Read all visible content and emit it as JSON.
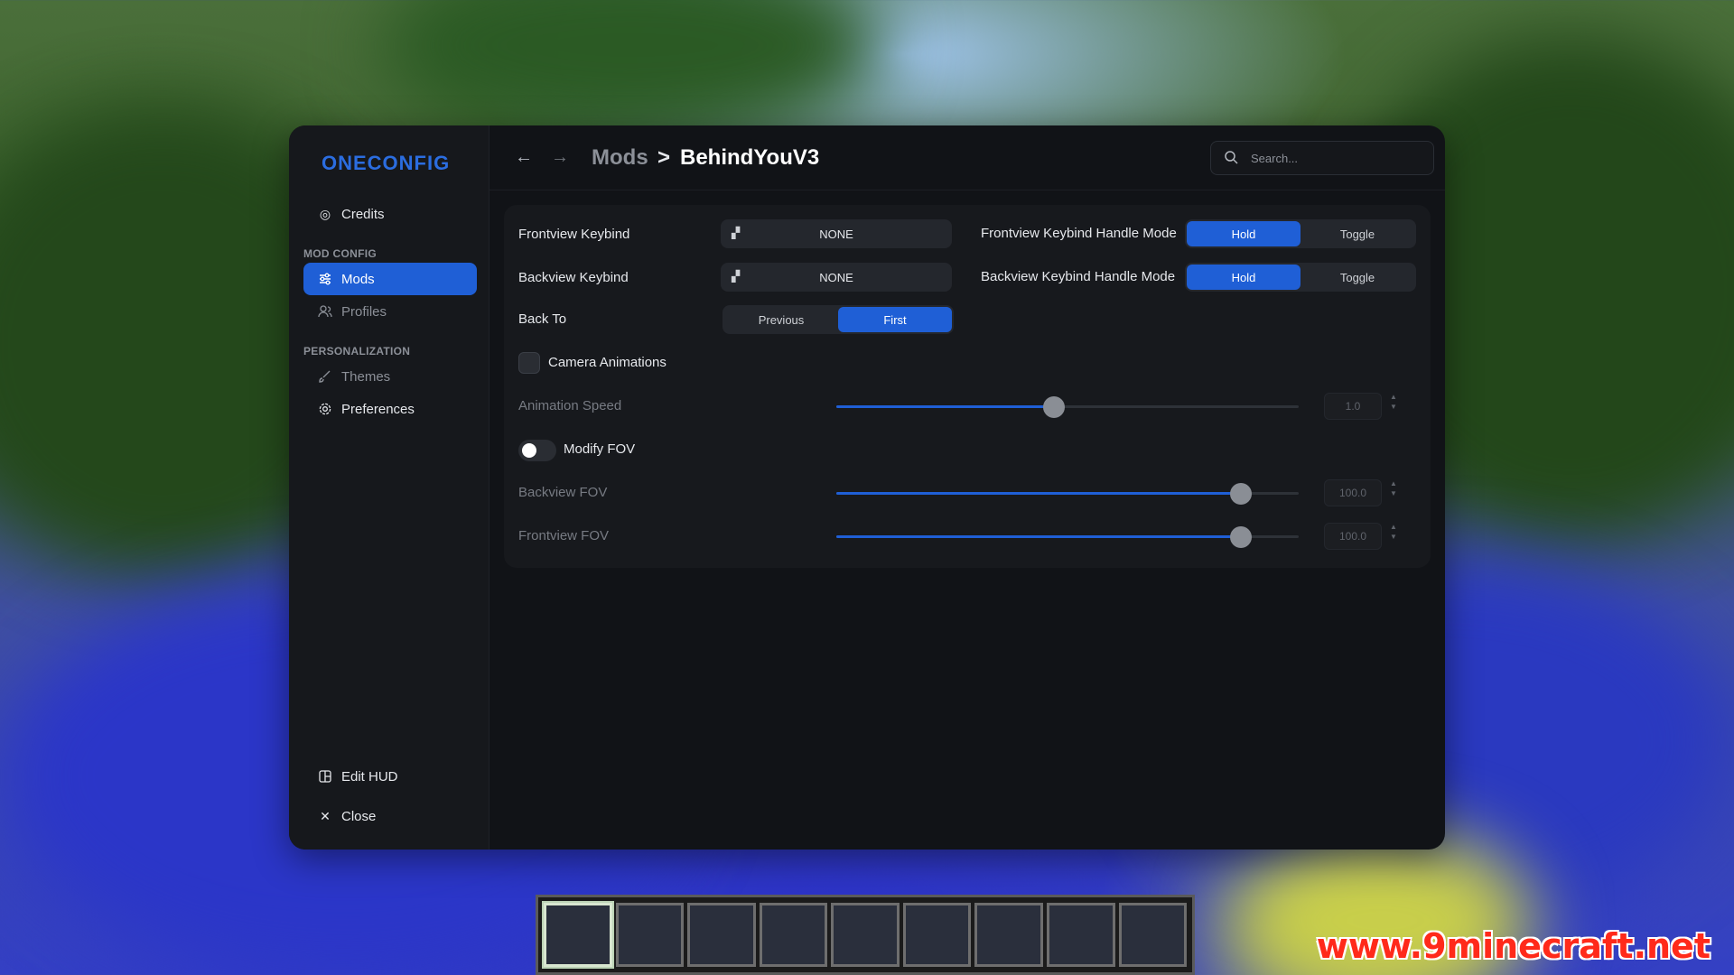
{
  "app": {
    "logo": "ONECONFIG"
  },
  "sidebar": {
    "credits": "Credits",
    "section_mod_config": "MOD CONFIG",
    "mods": "Mods",
    "profiles": "Profiles",
    "section_personalization": "PERSONALIZATION",
    "themes": "Themes",
    "preferences": "Preferences",
    "edit_hud": "Edit HUD",
    "close": "Close"
  },
  "header": {
    "breadcrumb_parent": "Mods",
    "breadcrumb_separator": ">",
    "breadcrumb_current": "BehindYouV3",
    "search_placeholder": "Search..."
  },
  "settings": {
    "frontview_keybind": {
      "label": "Frontview Keybind",
      "value": "NONE"
    },
    "frontview_handle_mode": {
      "label": "Frontview Keybind Handle Mode",
      "options": [
        "Hold",
        "Toggle"
      ],
      "selected": "Hold"
    },
    "backview_keybind": {
      "label": "Backview Keybind",
      "value": "NONE"
    },
    "backview_handle_mode": {
      "label": "Backview Keybind Handle Mode",
      "options": [
        "Hold",
        "Toggle"
      ],
      "selected": "Hold"
    },
    "back_to": {
      "label": "Back To",
      "options": [
        "Previous",
        "First"
      ],
      "selected": "First"
    },
    "camera_animations": {
      "label": "Camera Animations",
      "checked": false
    },
    "animation_speed": {
      "label": "Animation Speed",
      "value": "1.0",
      "fraction": 0.47
    },
    "modify_fov": {
      "label": "Modify FOV",
      "enabled": false
    },
    "backview_fov": {
      "label": "Backview FOV",
      "value": "100.0",
      "fraction": 0.875
    },
    "frontview_fov": {
      "label": "Frontview FOV",
      "value": "100.0",
      "fraction": 0.875
    }
  },
  "watermark": "www.9minecraft.net",
  "colors": {
    "accent": "#1f5fd6",
    "window_bg": "#111317",
    "panel_bg": "#17191d"
  }
}
